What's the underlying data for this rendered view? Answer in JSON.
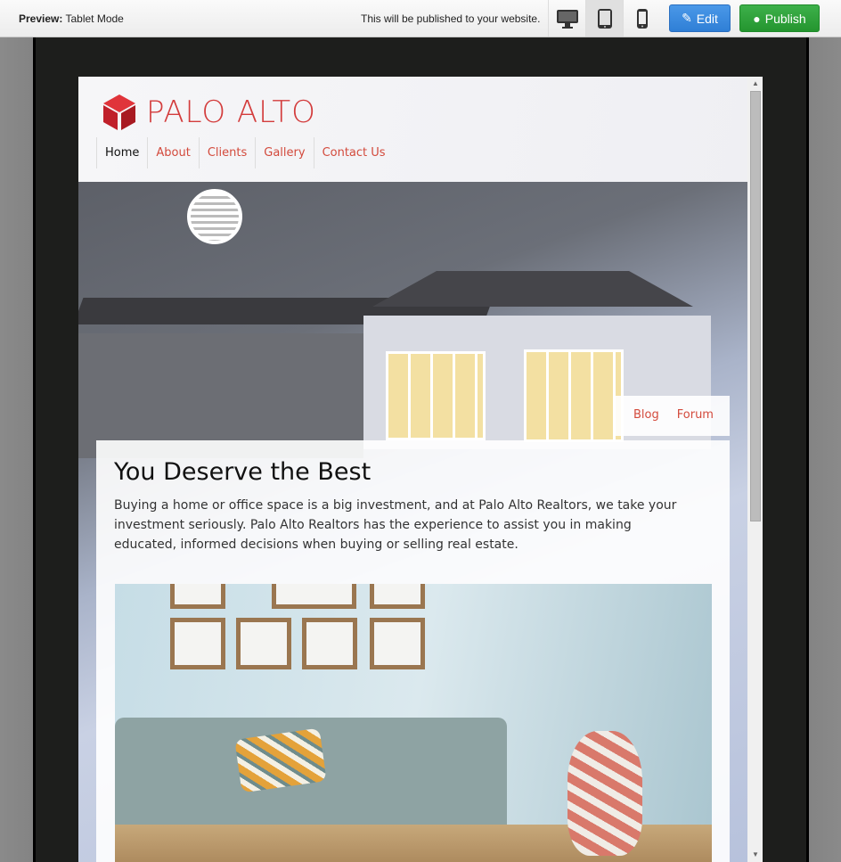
{
  "toolbar": {
    "preview_label": "Preview:",
    "preview_mode": "Tablet Mode",
    "publish_message": "This will be published to your website.",
    "devices": [
      {
        "icon": "desktop-icon",
        "active": false
      },
      {
        "icon": "tablet-icon",
        "active": true
      },
      {
        "icon": "phone-icon",
        "active": false
      }
    ],
    "edit_label": "Edit",
    "publish_label": "Publish",
    "edit_color": "#2f7fd6",
    "publish_color": "#24952f"
  },
  "site": {
    "logo_text": "PALO ALTO",
    "brand_color": "#d33c3c",
    "nav": [
      "Home",
      "About",
      "Clients",
      "Gallery",
      "Contact Us"
    ],
    "subnav": [
      "Blog",
      "Forum"
    ],
    "heading": "You Deserve the Best",
    "body": "Buying a home or office space is a big investment, and at Palo Alto Realtors, we take your investment seriously. Palo Alto Realtors has the experience to assist you in making educated, informed decisions when buying or selling real estate."
  }
}
